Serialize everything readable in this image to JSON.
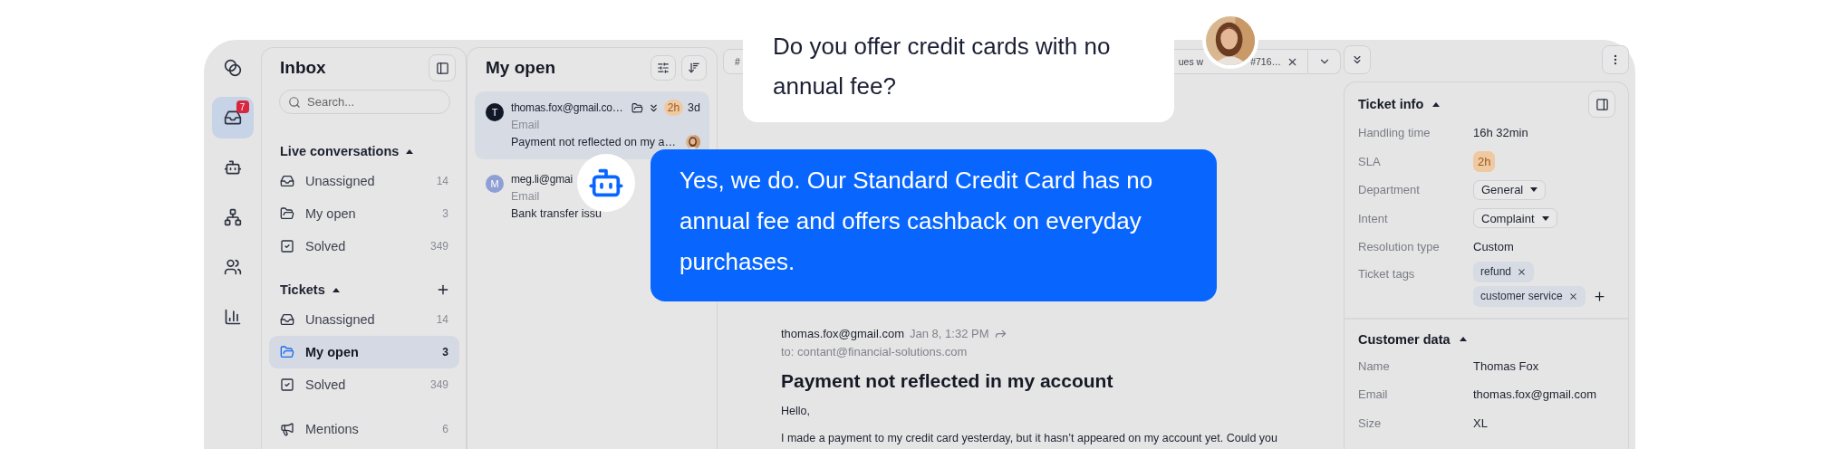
{
  "rail": [
    {
      "kind": "apps",
      "selected": false
    },
    {
      "kind": "inbox",
      "selected": true,
      "badge": "7"
    },
    {
      "kind": "bot",
      "selected": false
    },
    {
      "kind": "flows",
      "selected": false
    },
    {
      "kind": "contacts",
      "selected": false
    },
    {
      "kind": "reports",
      "selected": false
    }
  ],
  "inbox": {
    "title": "Inbox",
    "search": {
      "placeholder": "Search..."
    },
    "sections": [
      {
        "title": "Live conversations",
        "expanded": true,
        "items": [
          {
            "kind": "unassigned",
            "label": "Unassigned",
            "count": "14",
            "selected": false
          },
          {
            "kind": "open",
            "label": "My open",
            "count": "3",
            "selected": false
          },
          {
            "kind": "solved",
            "label": "Solved",
            "count": "349",
            "selected": false
          }
        ]
      },
      {
        "title": "Tickets",
        "expanded": true,
        "can_add": true,
        "items": [
          {
            "kind": "unassigned",
            "label": "Unassigned",
            "count": "14",
            "selected": false
          },
          {
            "kind": "open",
            "label": "My open",
            "count": "3",
            "selected": true
          },
          {
            "kind": "solved",
            "label": "Solved",
            "count": "349",
            "selected": false
          }
        ]
      }
    ],
    "mentions": {
      "label": "Mentions",
      "count": "6",
      "selected": false
    }
  },
  "conversations": {
    "title": "My open",
    "items": [
      {
        "initial": "T",
        "color": "#111827",
        "sender": "thomas.fox@gmail.co…",
        "channel": "Email",
        "subject": "Payment not reflected on my a…",
        "sla": "2h",
        "age": "3d",
        "selected": true,
        "assignee_photo": true
      },
      {
        "initial": "M",
        "color": "#8d9fd4",
        "sender": "meg.li@gmai",
        "channel": "Email",
        "subject": "Bank transfer issu",
        "selected": false
      }
    ]
  },
  "tabs": [
    {
      "label": "#"
    },
    {
      "label": "ues w",
      "label_end": "#716…",
      "closable": true
    }
  ],
  "email": {
    "sender": "thomas.fox@gmail.com",
    "time": "Jan 8, 1:32 PM",
    "to": "to: contant@financial-solutions.com",
    "subject": "Payment not reflected in my account",
    "greeting": "Hello,",
    "body": "I made a payment to my credit card yesterday, but it hasn’t appeared on my account yet. Could you"
  },
  "details": [
    {
      "title": "Ticket info",
      "expanded": true,
      "fields": [
        {
          "kind": "text",
          "label": "Handling time",
          "value": "16h 32min"
        },
        {
          "kind": "badge",
          "label": "SLA",
          "value": "2h"
        },
        {
          "kind": "select",
          "label": "Department",
          "value": "General"
        },
        {
          "kind": "select",
          "label": "Intent",
          "value": "Complaint"
        },
        {
          "kind": "text",
          "label": "Resolution type",
          "value": "Custom"
        },
        {
          "kind": "tags",
          "label": "Ticket tags",
          "tags": [
            "refund",
            "customer service"
          ]
        }
      ]
    },
    {
      "title": "Customer data",
      "expanded": true,
      "fields": [
        {
          "kind": "text",
          "label": "Name",
          "value": "Thomas Fox"
        },
        {
          "kind": "text",
          "label": "Email",
          "value": "thomas.fox@gmail.com"
        },
        {
          "kind": "text",
          "label": "Size",
          "value": "XL"
        }
      ]
    }
  ],
  "chat": {
    "question": "Do you offer credit cards with no annual fee?",
    "answer": "Yes, we do. Our Standard Credit Card has no annual fee and offers cashback on everyday purchases."
  }
}
